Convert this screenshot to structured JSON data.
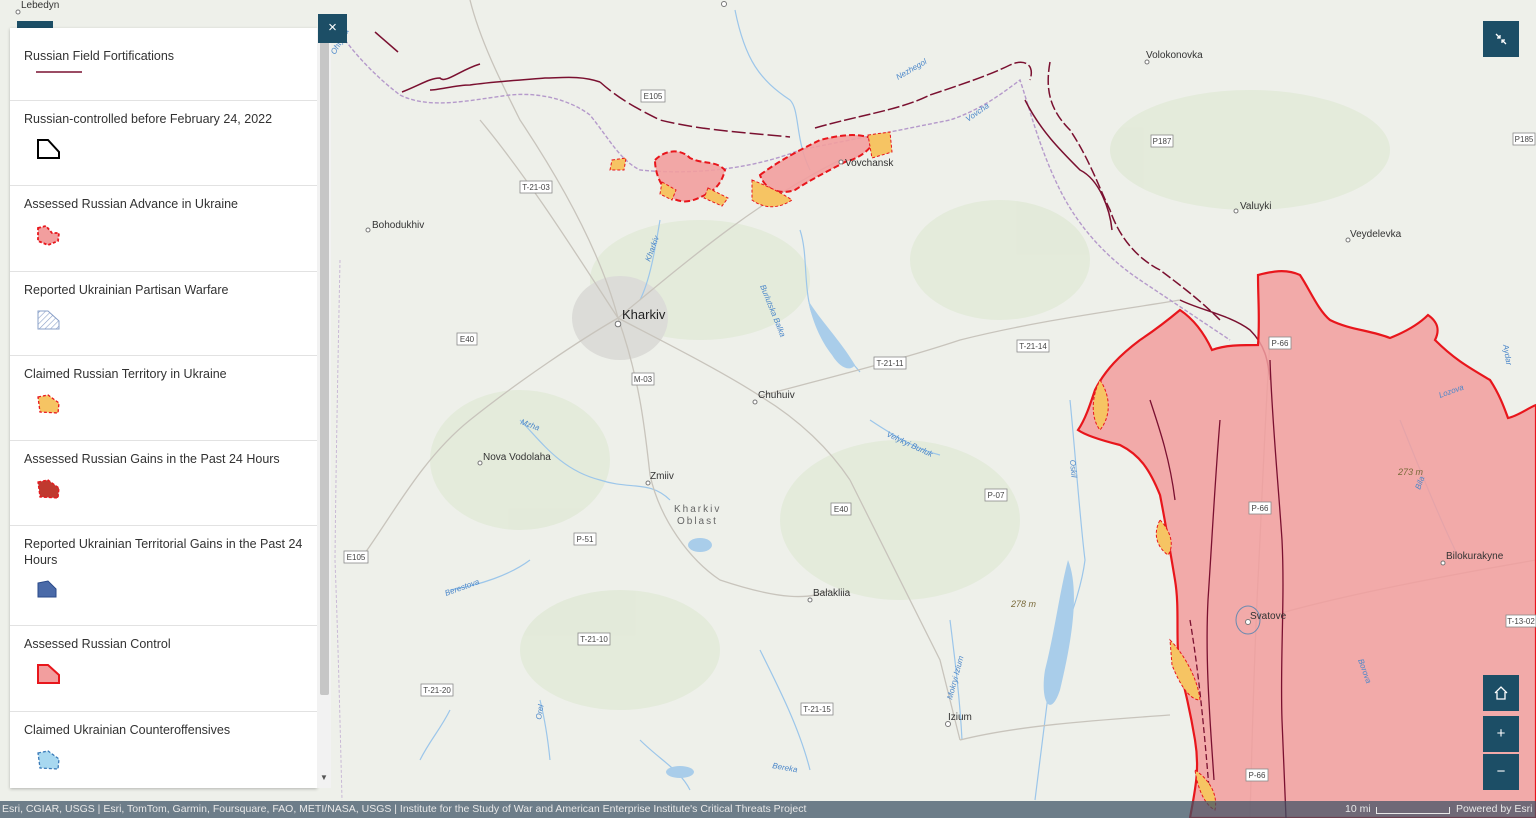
{
  "legend": {
    "items": [
      {
        "label": "Russian Field Fortifications"
      },
      {
        "label": "Russian-controlled before February 24, 2022"
      },
      {
        "label": "Assessed Russian Advance in Ukraine"
      },
      {
        "label": "Reported Ukrainian Partisan Warfare"
      },
      {
        "label": "Claimed Russian Territory in Ukraine"
      },
      {
        "label": "Assessed Russian Gains in the Past 24 Hours"
      },
      {
        "label": "Reported Ukrainian Territorial Gains in the Past 24 Hours"
      },
      {
        "label": "Assessed Russian Control"
      },
      {
        "label": "Claimed Ukrainian Counteroffensives"
      }
    ],
    "close_label": "×"
  },
  "controls": {
    "expand_icon": "collapse-arrows-icon",
    "home_icon": "home-icon",
    "zoom_in_label": "+",
    "zoom_out_label": "−"
  },
  "map": {
    "places": {
      "lebedyn": "Lebedyn",
      "volokonovka": "Volokonovka",
      "vovchansk": "Vovchansk",
      "valuyki": "Valuyki",
      "veydelevka": "Veydelevka",
      "bohodukhiv": "Bohodukhiv",
      "kharkiv": "Kharkiv",
      "chuhuiv": "Chuhuiv",
      "nova_vodolaha": "Nova Vodolaha",
      "zmiiv": "Zmiiv",
      "kharkiv_oblast_1": "Kharkiv",
      "kharkiv_oblast_2": "Oblast",
      "balakliia": "Balakliia",
      "izium": "Izium",
      "svatove": "Svatove",
      "bilokurakyne": "Bilokurakyne"
    },
    "roads": [
      "E105",
      "P187",
      "P185",
      "T-21-03",
      "E40",
      "M-03",
      "T-21-11",
      "T-21-14",
      "P-66",
      "P-66",
      "P-07",
      "E40",
      "P-51",
      "E105",
      "T-21-10",
      "T-21-20",
      "T-21-15",
      "P-66",
      "T-13-02",
      "P-66"
    ],
    "elevations": [
      "273 m",
      "278 m"
    ],
    "rivers": [
      "Nezhegol",
      "Vovcha",
      "Kharkiv",
      "Burlutska Balka",
      "Mzha",
      "Velykyi Burluk",
      "Oskil",
      "Berestova",
      "Orel",
      "Bereka",
      "Siverskyi",
      "Krasna",
      "Lozova",
      "Aydar",
      "Bila",
      "Mokryi Izium",
      "Ohtyrka",
      "Borova"
    ],
    "colors": {
      "russian_control_fill": "#f29e9e",
      "russian_control_stroke": "#e8161c",
      "claimed_russian_fill": "#f6c463",
      "fortification": "#7a1030",
      "border": "#b59acb"
    }
  },
  "attribution": {
    "text": "Esri, CGIAR, USGS | Esri, TomTom, Garmin, Foursquare, FAO, METI/NASA, USGS | Institute for the Study of War and American Enterprise Institute's Critical Threats Project",
    "scale": "10 mi",
    "powered_by": "Powered by Esri"
  }
}
